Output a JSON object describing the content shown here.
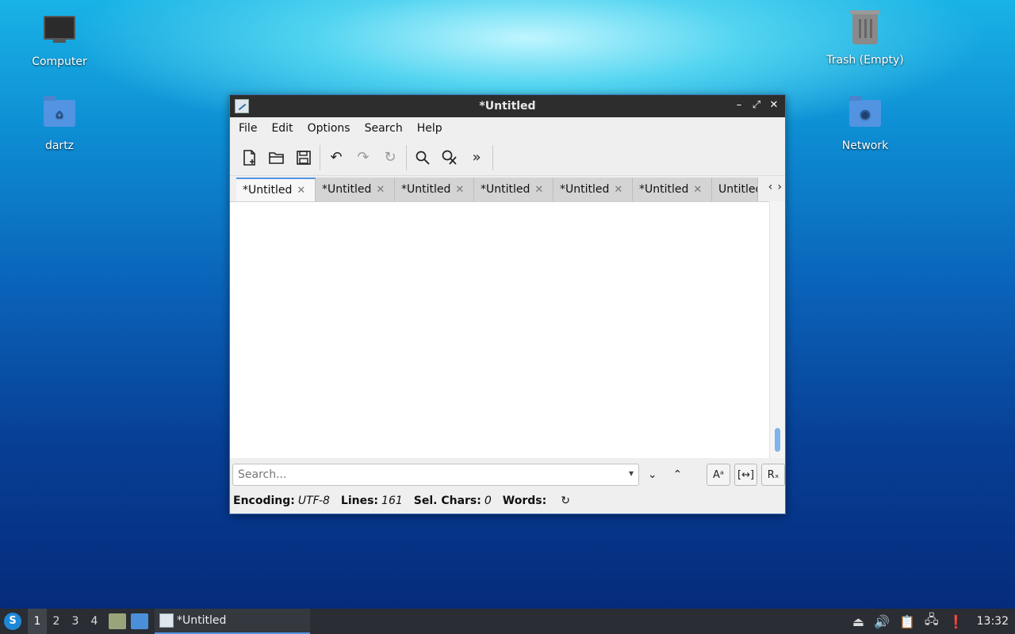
{
  "desktop": {
    "icons": [
      {
        "label": "Computer"
      },
      {
        "label": "dartz"
      },
      {
        "label": "Trash (Empty)"
      },
      {
        "label": "Network"
      }
    ]
  },
  "window": {
    "title": "*Untitled",
    "controls": {
      "minimize": "–",
      "maximize": "⤢",
      "close": "✕"
    },
    "menu": [
      "File",
      "Edit",
      "Options",
      "Search",
      "Help"
    ],
    "toolbar": {
      "new": "new-document-icon",
      "open": "open-folder-icon",
      "save": "save-icon",
      "undo": "undo-icon",
      "redo": "redo-icon",
      "reload": "reload-icon",
      "find": "search-icon",
      "replace": "find-replace-icon",
      "more": "more-chevrons-icon"
    },
    "tabs": [
      {
        "label": "*Untitled",
        "close": "✕",
        "active": true
      },
      {
        "label": "*Untitled",
        "close": "✕"
      },
      {
        "label": "*Untitled",
        "close": "✕"
      },
      {
        "label": "*Untitled",
        "close": "✕"
      },
      {
        "label": "*Untitled",
        "close": "✕"
      },
      {
        "label": "*Untitled",
        "close": "✕"
      },
      {
        "label": "Untitled"
      }
    ],
    "tab_arrows": {
      "left": "‹",
      "right": "›"
    },
    "search": {
      "placeholder": "Search...",
      "down": "⌄",
      "up": "⌃",
      "match_case": "Aᵃ",
      "whole_word": "[↔]",
      "regex": "Rₓ"
    },
    "status": {
      "encoding_label": "Encoding:",
      "encoding_value": "UTF-8",
      "lines_label": "Lines:",
      "lines_value": "161",
      "sel_label": "Sel. Chars:",
      "sel_value": "0",
      "words_label": "Words:",
      "words_refresh": "↻"
    }
  },
  "taskbar": {
    "start": "S",
    "workspaces": [
      "1",
      "2",
      "3",
      "4"
    ],
    "task_title": "*Untitled",
    "clock": "13:32"
  }
}
